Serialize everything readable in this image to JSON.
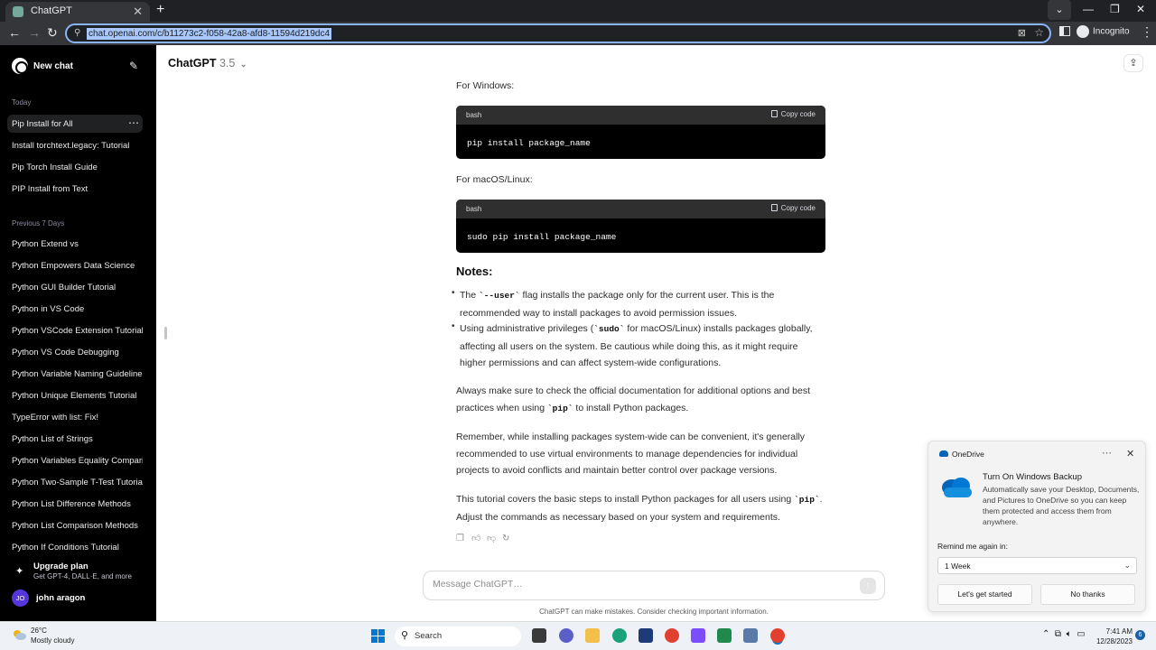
{
  "browser": {
    "tab_title": "ChatGPT",
    "url": "chat.openai.com/c/b11273c2-f058-42a8-afd8-11594d219dc4",
    "profile_label": "Incognito"
  },
  "sidebar": {
    "new_chat": "New chat",
    "sections": [
      {
        "label": "Today"
      },
      {
        "label": "Previous 7 Days"
      }
    ],
    "today_items": [
      "Pip Install for All",
      "Install torchtext.legacy: Tutorial",
      "Pip Torch Install Guide",
      "PIP Install from Text"
    ],
    "week_items": [
      "Python Extend vs",
      "Python Empowers Data Science",
      "Python GUI Builder Tutorial",
      "Python in VS Code",
      "Python VSCode Extension Tutorial",
      "Python VS Code Debugging",
      "Python Variable Naming Guidelines",
      "Python Unique Elements Tutorial",
      "TypeError with list: Fix!",
      "Python List of Strings",
      "Python Variables Equality Comparison",
      "Python Two-Sample T-Test Tutorial",
      "Python List Difference Methods",
      "Python List Comparison Methods",
      "Python If Conditions Tutorial"
    ],
    "upgrade_title": "Upgrade plan",
    "upgrade_sub": "Get GPT-4, DALL·E, and more",
    "user_initials": "JO",
    "user_name": "john aragon"
  },
  "header": {
    "model_name": "ChatGPT",
    "model_version": "3.5"
  },
  "content": {
    "windows_label": "For Windows:",
    "mac_label": "For macOS/Linux:",
    "code_lang": "bash",
    "copy_label": "Copy code",
    "code_windows": "pip install package_name",
    "code_mac": "sudo pip install package_name",
    "notes_heading": "Notes:",
    "note1_a": "The ",
    "note1_code": "`--user`",
    "note1_b": " flag installs the package only for the current user. This is the recommended way to install packages to avoid permission issues.",
    "note2_a": "Using administrative privileges (",
    "note2_code": "`sudo`",
    "note2_b": " for macOS/Linux) installs packages globally, affecting all users on the system. Be cautious while doing this, as it might require higher permissions and can affect system-wide configurations.",
    "para1_a": "Always make sure to check the official documentation for additional options and best practices when using ",
    "para1_code": "`pip`",
    "para1_b": " to install Python packages.",
    "para2": "Remember, while installing packages system-wide can be convenient, it's generally recommended to use virtual environments to manage dependencies for individual projects to avoid conflicts and maintain better control over package versions.",
    "para3_a": "This tutorial covers the basic steps to install Python packages for all users using ",
    "para3_code": "`pip`",
    "para3_b": ". Adjust the commands as necessary based on your system and requirements."
  },
  "composer": {
    "placeholder": "Message ChatGPT…",
    "disclaimer": "ChatGPT can make mistakes. Consider checking important information."
  },
  "toast": {
    "app_name": "OneDrive",
    "heading": "Turn On Windows Backup",
    "body": "Automatically save your Desktop, Documents, and Pictures to OneDrive so you can keep them protected and access them from anywhere.",
    "remind_label": "Remind me again in:",
    "remind_value": "1 Week",
    "primary_button": "Let's get started",
    "secondary_button": "No thanks"
  },
  "taskbar": {
    "temperature": "26°C",
    "condition": "Mostly cloudy",
    "search_label": "Search",
    "time": "7:41 AM",
    "date": "12/28/2023",
    "notification_count": "6"
  },
  "colors": {
    "sidebar_bg": "#000000",
    "code_bg": "#000000",
    "accent_blue": "#0078d4"
  }
}
